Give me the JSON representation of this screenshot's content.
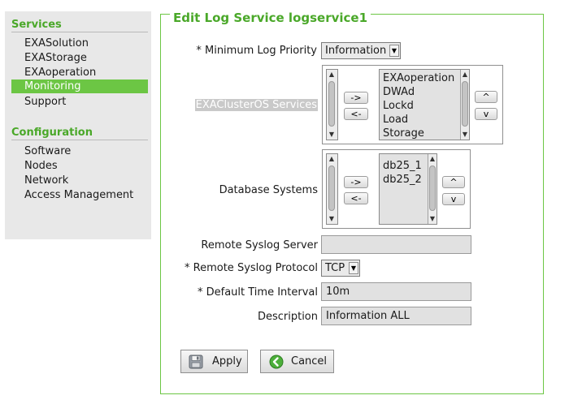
{
  "sidebar": {
    "services_title": "Services",
    "services": [
      "EXASolution",
      "EXAStorage",
      "EXAoperation",
      "Monitoring",
      "Support"
    ],
    "active": "Monitoring",
    "configuration_title": "Configuration",
    "configuration": [
      "Software",
      "Nodes",
      "Network",
      "Access Management"
    ]
  },
  "form": {
    "title": "Edit Log Service logservice1",
    "min_priority_label": "* Minimum Log Priority",
    "min_priority_value": "Information",
    "cluster_services_label": "EXAClusterOS Services",
    "cluster_services_options": [
      "EXAoperation",
      "DWAd",
      "Lockd",
      "Load",
      "Storage"
    ],
    "database_systems_label": "Database Systems",
    "database_systems_options": [
      "db25_1",
      "db25_2"
    ],
    "add_arrow": "->",
    "remove_arrow": "<-",
    "move_up": "^",
    "move_down": "v",
    "remote_server_label": "Remote Syslog Server",
    "remote_server_value": "",
    "remote_protocol_label": "* Remote Syslog Protocol",
    "remote_protocol_value": "TCP",
    "time_interval_label": "* Default Time Interval",
    "time_interval_value": "10m",
    "description_label": "Description",
    "description_value": "Information ALL",
    "apply_label": "Apply",
    "cancel_label": "Cancel"
  },
  "colors": {
    "accent": "#6cc644",
    "heading": "#4aa829",
    "sidebar_bg": "#e8e8e8"
  }
}
